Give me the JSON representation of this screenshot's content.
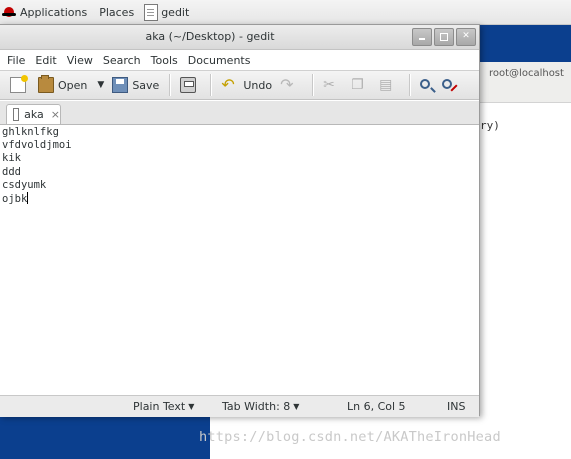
{
  "top_panel": {
    "applications_label": "Applications",
    "places_label": "Places",
    "task_label": "gedit"
  },
  "terminal": {
    "title": "root@localhost",
    "text_fragment": "ry)"
  },
  "window": {
    "title": "aka (~/Desktop) - gedit",
    "controls": [
      "minimize",
      "maximize",
      "close"
    ],
    "close_glyph": "✕"
  },
  "menu": [
    "File",
    "Edit",
    "View",
    "Search",
    "Tools",
    "Documents"
  ],
  "toolbar": {
    "open_label": "Open",
    "open_arrow": "▼",
    "save_label": "Save",
    "undo_label": "Undo",
    "undo_glyph": "↶",
    "redo_glyph": "↷",
    "cut_glyph": "✂",
    "copy_glyph": "❐",
    "paste_glyph": "▤",
    "icons": [
      "new-document-icon",
      "open-folder-icon",
      "save-icon",
      "print-icon",
      "undo-icon",
      "redo-icon",
      "cut-icon",
      "copy-icon",
      "paste-icon",
      "find-icon",
      "find-replace-icon"
    ]
  },
  "tab": {
    "label": "aka",
    "close_glyph": "×"
  },
  "editor": {
    "lines": [
      "ghlknlfkg",
      "vfdvoldjmoi",
      "kik",
      "ddd",
      "csdyumk",
      "ojbk"
    ]
  },
  "statusbar": {
    "language": "Plain Text",
    "tab_width": "Tab Width:  8",
    "dropdown_glyph": "▼",
    "position": "Ln 6, Col 5",
    "mode": "INS"
  },
  "watermark": "https://blog.csdn.net/AKATheIronHead",
  "colors": {
    "desktop_blue": "#0b3f8e",
    "panel_bg": "#e6e6e6"
  }
}
